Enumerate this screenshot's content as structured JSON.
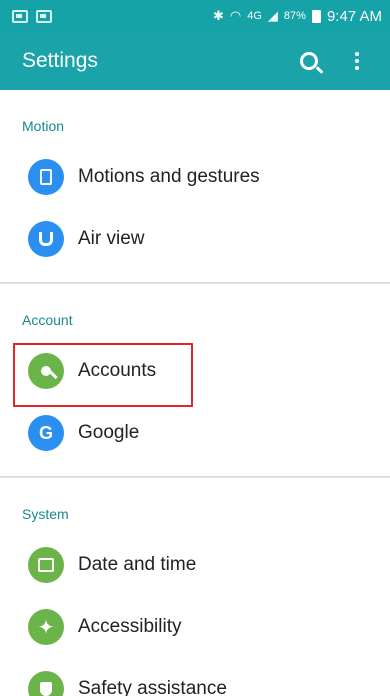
{
  "status_bar": {
    "network": "4G",
    "battery": "87%",
    "time": "9:47 AM"
  },
  "toolbar": {
    "title": "Settings"
  },
  "sections": [
    {
      "header": "Motion",
      "items": [
        {
          "label": "Motions and gestures"
        },
        {
          "label": "Air view"
        }
      ]
    },
    {
      "header": "Account",
      "items": [
        {
          "label": "Accounts"
        },
        {
          "label": "Google",
          "icon_text": "G"
        }
      ]
    },
    {
      "header": "System",
      "items": [
        {
          "label": "Date and time"
        },
        {
          "label": "Accessibility"
        },
        {
          "label": "Safety assistance"
        }
      ]
    }
  ],
  "icons": {
    "motions": "motion-gestures-icon",
    "airview": "air-view-icon",
    "accounts": "key-icon",
    "google": "google-icon",
    "datetime": "calendar-icon",
    "accessibility": "accessibility-icon",
    "safety": "safety-icon"
  },
  "colors": {
    "primary": "#1aa4aa",
    "section_header": "#17888e",
    "blue_icon": "#2a8ff1",
    "green_icon": "#6ab44a",
    "highlight": "#e0262a"
  }
}
